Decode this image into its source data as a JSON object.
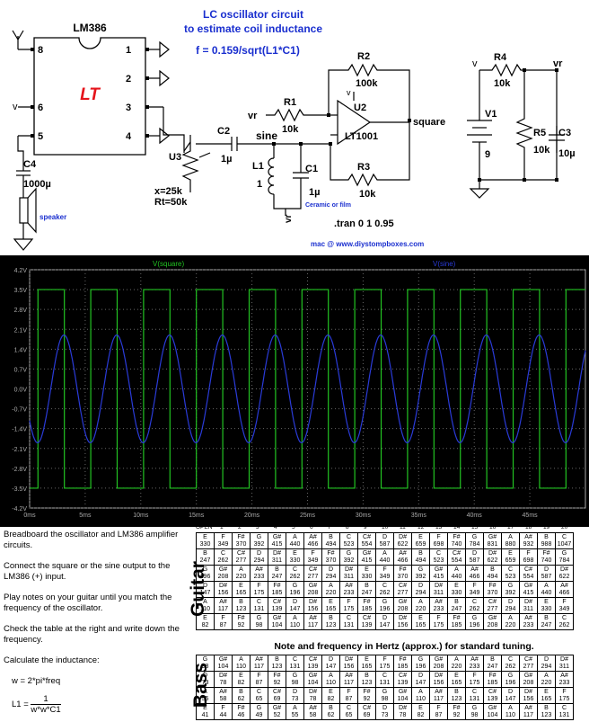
{
  "schematic": {
    "title_line1": "LC oscillator circuit",
    "title_line2": "to estimate coil inductance",
    "formula": "f = 0.159/sqrt(L1*C1)",
    "lm386": {
      "name": "LM386",
      "pins": [
        "8",
        "1",
        "2",
        "6",
        "3",
        "5",
        "4"
      ]
    },
    "labels": {
      "v": "v",
      "vr": "vr",
      "square": "square",
      "sine": "sine",
      "u2": "U2",
      "u2_part": "LT1001",
      "u3": "U3",
      "u3_x": "x=25k",
      "u3_rt": "Rt=50k",
      "r1": "R1",
      "r1_val": "10k",
      "r2": "R2",
      "r2_val": "100k",
      "r3": "R3",
      "r3_val": "10k",
      "r4": "R4",
      "r4_val": "10k",
      "r5": "R5",
      "r5_val": "10k",
      "c1": "C1",
      "c1_val": "1µ",
      "c2": "C2",
      "c2_val": "1µ",
      "c3": "C3",
      "c3_val": "10µ",
      "c4": "C4",
      "c4_val": "1000µ",
      "l1": "L1",
      "l1_val": "1",
      "v1": "V1",
      "v1_val": "9",
      "ceramic": "Ceramic or film",
      "speaker": "speaker",
      "tran": ".tran 0 1 0.95",
      "credit": "mac @ www.diystompboxes.com"
    }
  },
  "chart_data": {
    "type": "line",
    "series": [
      {
        "name": "V(square)",
        "color": "#22c322",
        "shape": "square",
        "amplitude": 3.5,
        "period_ms": 4.75,
        "phase_ms": 0.75
      },
      {
        "name": "V(sine)",
        "color": "#2a3bd8",
        "shape": "sine",
        "amplitude": 1.9,
        "period_ms": 4.75,
        "phase_ms": 1.9
      }
    ],
    "xlabel": "",
    "ylabel": "",
    "xlim": [
      0,
      50
    ],
    "ylim": [
      -4.2,
      4.2
    ],
    "x_ticks": [
      "0ms",
      "5ms",
      "10ms",
      "15ms",
      "20ms",
      "25ms",
      "30ms",
      "35ms",
      "40ms",
      "45ms"
    ],
    "x_tick_values": [
      0,
      5,
      10,
      15,
      20,
      25,
      30,
      35,
      40,
      45
    ],
    "y_ticks": [
      "4.2V",
      "3.5V",
      "2.8V",
      "2.1V",
      "1.4V",
      "0.7V",
      "0.0V",
      "-0.7V",
      "-1.4V",
      "-2.1V",
      "-2.8V",
      "-3.5V",
      "-4.2V"
    ],
    "y_tick_values": [
      4.2,
      3.5,
      2.8,
      2.1,
      1.4,
      0.7,
      0.0,
      -0.7,
      -1.4,
      -2.1,
      -2.8,
      -3.5,
      -4.2
    ],
    "grid": true
  },
  "instructions": {
    "p1": "Breadboard the oscillator and LM386 amplifier circuits.",
    "p2": "Connect the square or the sine output to the LM386 (+) input.",
    "p3": "Play notes on your guitar until you match the frequency of the oscillator.",
    "p4": "Check the table at the right and write down the frequency.",
    "p5": "Calculate the inductance:",
    "eq1": "w = 2*pi*freq",
    "eq2_left": "L1 = ",
    "eq2_num": "1",
    "eq2_den": "w*w*C1"
  },
  "frets_header": [
    "OPEN",
    "1",
    "2",
    "3",
    "4",
    "5",
    "6",
    "7",
    "8",
    "9",
    "10",
    "11",
    "12",
    "13",
    "14",
    "15",
    "16",
    "17",
    "18",
    "19",
    "20"
  ],
  "caption": "Note and frequency in Hertz (approx.) for standard tuning.",
  "guitar_label": "Guitar",
  "bass_label": "Bass",
  "guitar": [
    [
      [
        "E",
        "330"
      ],
      [
        "F",
        "349"
      ],
      [
        "F#",
        "370"
      ],
      [
        "G",
        "392"
      ],
      [
        "G#",
        "415"
      ],
      [
        "A",
        "440"
      ],
      [
        "A#",
        "466"
      ],
      [
        "B",
        "494"
      ],
      [
        "C",
        "523"
      ],
      [
        "C#",
        "554"
      ],
      [
        "D",
        "587"
      ],
      [
        "D#",
        "622"
      ],
      [
        "E",
        "659"
      ],
      [
        "F",
        "698"
      ],
      [
        "F#",
        "740"
      ],
      [
        "G",
        "784"
      ],
      [
        "G#",
        "831"
      ],
      [
        "A",
        "880"
      ],
      [
        "A#",
        "932"
      ],
      [
        "B",
        "988"
      ],
      [
        "C",
        "1047"
      ]
    ],
    [
      [
        "B",
        "247"
      ],
      [
        "C",
        "262"
      ],
      [
        "C#",
        "277"
      ],
      [
        "D",
        "294"
      ],
      [
        "D#",
        "311"
      ],
      [
        "E",
        "330"
      ],
      [
        "F",
        "349"
      ],
      [
        "F#",
        "370"
      ],
      [
        "G",
        "392"
      ],
      [
        "G#",
        "415"
      ],
      [
        "A",
        "440"
      ],
      [
        "A#",
        "466"
      ],
      [
        "B",
        "494"
      ],
      [
        "C",
        "523"
      ],
      [
        "C#",
        "554"
      ],
      [
        "D",
        "587"
      ],
      [
        "D#",
        "622"
      ],
      [
        "E",
        "659"
      ],
      [
        "F",
        "698"
      ],
      [
        "F#",
        "740"
      ],
      [
        "G",
        "784"
      ]
    ],
    [
      [
        "G",
        "196"
      ],
      [
        "G#",
        "208"
      ],
      [
        "A",
        "220"
      ],
      [
        "A#",
        "233"
      ],
      [
        "B",
        "247"
      ],
      [
        "C",
        "262"
      ],
      [
        "C#",
        "277"
      ],
      [
        "D",
        "294"
      ],
      [
        "D#",
        "311"
      ],
      [
        "E",
        "330"
      ],
      [
        "F",
        "349"
      ],
      [
        "F#",
        "370"
      ],
      [
        "G",
        "392"
      ],
      [
        "G#",
        "415"
      ],
      [
        "A",
        "440"
      ],
      [
        "A#",
        "466"
      ],
      [
        "B",
        "494"
      ],
      [
        "C",
        "523"
      ],
      [
        "C#",
        "554"
      ],
      [
        "D",
        "587"
      ],
      [
        "D#",
        "622"
      ]
    ],
    [
      [
        "D",
        "147"
      ],
      [
        "D#",
        "156"
      ],
      [
        "E",
        "165"
      ],
      [
        "F",
        "175"
      ],
      [
        "F#",
        "185"
      ],
      [
        "G",
        "196"
      ],
      [
        "G#",
        "208"
      ],
      [
        "A",
        "220"
      ],
      [
        "A#",
        "233"
      ],
      [
        "B",
        "247"
      ],
      [
        "C",
        "262"
      ],
      [
        "C#",
        "277"
      ],
      [
        "D",
        "294"
      ],
      [
        "D#",
        "311"
      ],
      [
        "E",
        "330"
      ],
      [
        "F",
        "349"
      ],
      [
        "F#",
        "370"
      ],
      [
        "G",
        "392"
      ],
      [
        "G#",
        "415"
      ],
      [
        "A",
        "440"
      ],
      [
        "A#",
        "466"
      ]
    ],
    [
      [
        "A",
        "110"
      ],
      [
        "A#",
        "117"
      ],
      [
        "B",
        "123"
      ],
      [
        "C",
        "131"
      ],
      [
        "C#",
        "139"
      ],
      [
        "D",
        "147"
      ],
      [
        "D#",
        "156"
      ],
      [
        "E",
        "165"
      ],
      [
        "F",
        "175"
      ],
      [
        "F#",
        "185"
      ],
      [
        "G",
        "196"
      ],
      [
        "G#",
        "208"
      ],
      [
        "A",
        "220"
      ],
      [
        "A#",
        "233"
      ],
      [
        "B",
        "247"
      ],
      [
        "C",
        "262"
      ],
      [
        "C#",
        "277"
      ],
      [
        "D",
        "294"
      ],
      [
        "D#",
        "311"
      ],
      [
        "E",
        "330"
      ],
      [
        "F",
        "349"
      ]
    ],
    [
      [
        "E",
        "82"
      ],
      [
        "F",
        "87"
      ],
      [
        "F#",
        "92"
      ],
      [
        "G",
        "98"
      ],
      [
        "G#",
        "104"
      ],
      [
        "A",
        "110"
      ],
      [
        "A#",
        "117"
      ],
      [
        "B",
        "123"
      ],
      [
        "C",
        "131"
      ],
      [
        "C#",
        "139"
      ],
      [
        "D",
        "147"
      ],
      [
        "D#",
        "156"
      ],
      [
        "E",
        "165"
      ],
      [
        "F",
        "175"
      ],
      [
        "F#",
        "185"
      ],
      [
        "G",
        "196"
      ],
      [
        "G#",
        "208"
      ],
      [
        "A",
        "220"
      ],
      [
        "A#",
        "233"
      ],
      [
        "B",
        "247"
      ],
      [
        "C",
        "262"
      ]
    ]
  ],
  "bass": [
    [
      [
        "G",
        "98"
      ],
      [
        "G#",
        "104"
      ],
      [
        "A",
        "110"
      ],
      [
        "A#",
        "117"
      ],
      [
        "B",
        "123"
      ],
      [
        "C",
        "131"
      ],
      [
        "C#",
        "139"
      ],
      [
        "D",
        "147"
      ],
      [
        "D#",
        "156"
      ],
      [
        "E",
        "165"
      ],
      [
        "F",
        "175"
      ],
      [
        "F#",
        "185"
      ],
      [
        "G",
        "196"
      ],
      [
        "G#",
        "208"
      ],
      [
        "A",
        "220"
      ],
      [
        "A#",
        "233"
      ],
      [
        "B",
        "247"
      ],
      [
        "C",
        "262"
      ],
      [
        "C#",
        "277"
      ],
      [
        "D",
        "294"
      ],
      [
        "D#",
        "311"
      ]
    ],
    [
      [
        "D",
        "73"
      ],
      [
        "D#",
        "78"
      ],
      [
        "E",
        "82"
      ],
      [
        "F",
        "87"
      ],
      [
        "F#",
        "92"
      ],
      [
        "G",
        "98"
      ],
      [
        "G#",
        "104"
      ],
      [
        "A",
        "110"
      ],
      [
        "A#",
        "117"
      ],
      [
        "B",
        "123"
      ],
      [
        "C",
        "131"
      ],
      [
        "C#",
        "139"
      ],
      [
        "D",
        "147"
      ],
      [
        "D#",
        "156"
      ],
      [
        "E",
        "165"
      ],
      [
        "F",
        "175"
      ],
      [
        "F#",
        "185"
      ],
      [
        "G",
        "196"
      ],
      [
        "G#",
        "208"
      ],
      [
        "A",
        "220"
      ],
      [
        "A#",
        "233"
      ]
    ],
    [
      [
        "A",
        "55"
      ],
      [
        "A#",
        "58"
      ],
      [
        "B",
        "62"
      ],
      [
        "C",
        "65"
      ],
      [
        "C#",
        "69"
      ],
      [
        "D",
        "73"
      ],
      [
        "D#",
        "78"
      ],
      [
        "E",
        "82"
      ],
      [
        "F",
        "87"
      ],
      [
        "F#",
        "92"
      ],
      [
        "G",
        "98"
      ],
      [
        "G#",
        "104"
      ],
      [
        "A",
        "110"
      ],
      [
        "A#",
        "117"
      ],
      [
        "B",
        "123"
      ],
      [
        "C",
        "131"
      ],
      [
        "C#",
        "139"
      ],
      [
        "D",
        "147"
      ],
      [
        "D#",
        "156"
      ],
      [
        "E",
        "165"
      ],
      [
        "F",
        "175"
      ]
    ],
    [
      [
        "E",
        "41"
      ],
      [
        "F",
        "44"
      ],
      [
        "F#",
        "46"
      ],
      [
        "G",
        "49"
      ],
      [
        "G#",
        "52"
      ],
      [
        "A",
        "55"
      ],
      [
        "A#",
        "58"
      ],
      [
        "B",
        "62"
      ],
      [
        "C",
        "65"
      ],
      [
        "C#",
        "69"
      ],
      [
        "D",
        "73"
      ],
      [
        "D#",
        "78"
      ],
      [
        "E",
        "82"
      ],
      [
        "F",
        "87"
      ],
      [
        "F#",
        "92"
      ],
      [
        "G",
        "98"
      ],
      [
        "G#",
        "104"
      ],
      [
        "A",
        "110"
      ],
      [
        "A#",
        "117"
      ],
      [
        "B",
        "123"
      ],
      [
        "C",
        "131"
      ]
    ]
  ]
}
